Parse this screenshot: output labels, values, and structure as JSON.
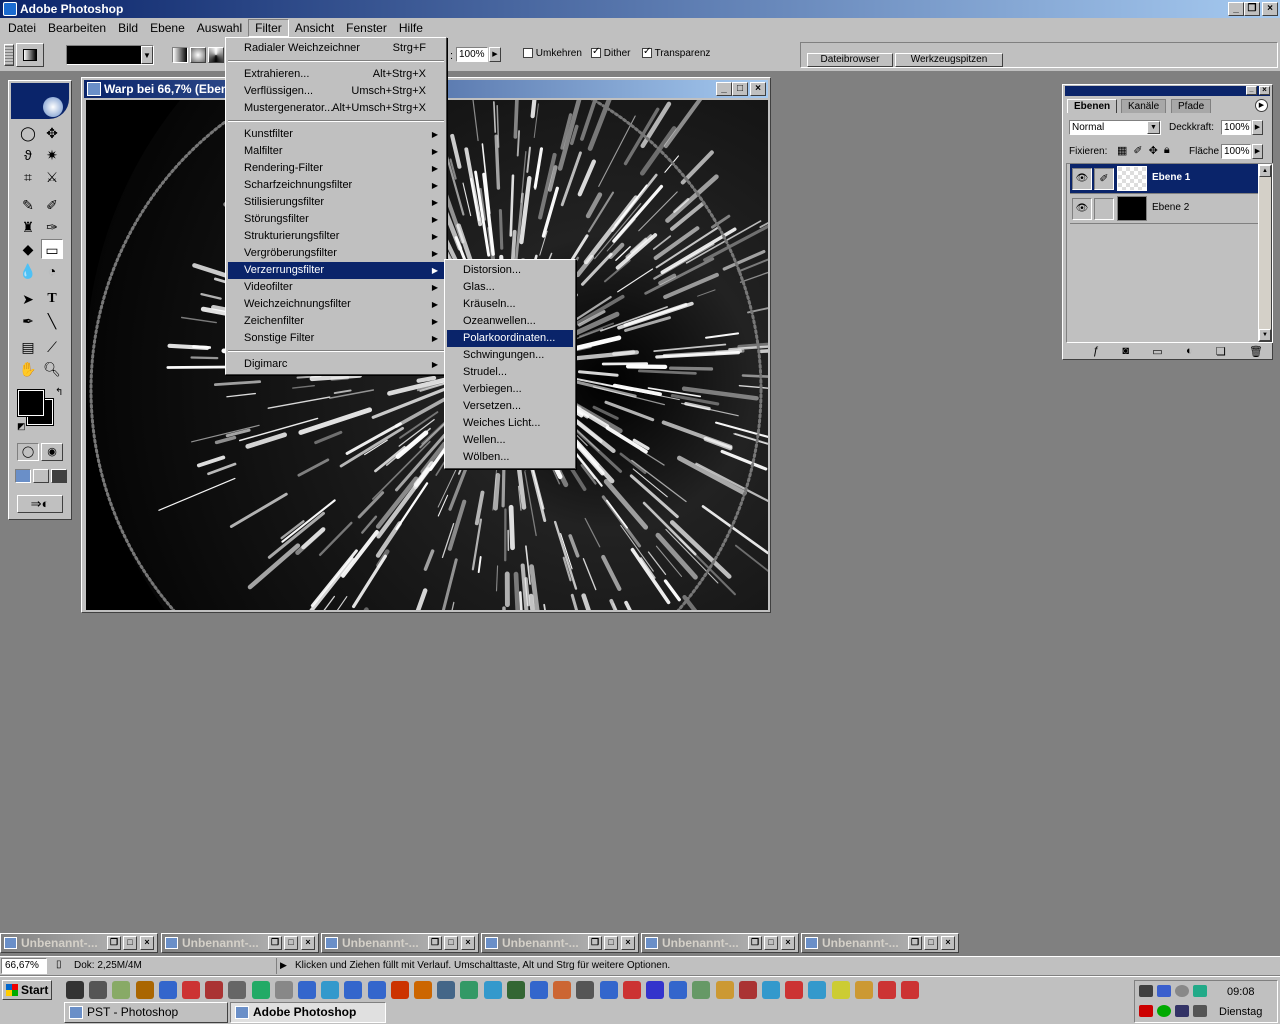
{
  "app": {
    "title": "Adobe Photoshop"
  },
  "menubar": [
    "Datei",
    "Bearbeiten",
    "Bild",
    "Ebene",
    "Auswahl",
    "Filter",
    "Ansicht",
    "Fenster",
    "Hilfe"
  ],
  "options": {
    "opacity_value": "100%",
    "reverse_label": "Umkehren",
    "dither_label": "Dither",
    "transparency_label": "Transparenz",
    "tab_filebrowser": "Dateibrowser",
    "tab_brushes": "Werkzeugspitzen"
  },
  "document": {
    "title": "Warp bei 66,7% (Ebene 1, RGB)"
  },
  "filter_menu": [
    {
      "label": "Radialer Weichzeichner",
      "shortcut": "Strg+F"
    },
    {
      "label": "Extrahieren...",
      "shortcut": "Alt+Strg+X"
    },
    {
      "label": "Verflüssigen...",
      "shortcut": "Umsch+Strg+X"
    },
    {
      "label": "Mustergenerator...",
      "shortcut": "Alt+Umsch+Strg+X"
    },
    {
      "label": "Kunstfilter"
    },
    {
      "label": "Malfilter"
    },
    {
      "label": "Rendering-Filter"
    },
    {
      "label": "Scharfzeichnungsfilter"
    },
    {
      "label": "Stilisierungsfilter"
    },
    {
      "label": "Störungsfilter"
    },
    {
      "label": "Strukturierungsfilter"
    },
    {
      "label": "Vergröberungsfilter"
    },
    {
      "label": "Verzerrungsfilter"
    },
    {
      "label": "Videofilter"
    },
    {
      "label": "Weichzeichnungsfilter"
    },
    {
      "label": "Zeichenfilter"
    },
    {
      "label": "Sonstige Filter"
    },
    {
      "label": "Digimarc"
    }
  ],
  "distort_submenu": [
    "Distorsion...",
    "Glas...",
    "Kräuseln...",
    "Ozeanwellen...",
    "Polarkoordinaten...",
    "Schwingungen...",
    "Strudel...",
    "Verbiegen...",
    "Versetzen...",
    "Weiches Licht...",
    "Wellen...",
    "Wölben..."
  ],
  "layers": {
    "tabs": [
      "Ebenen",
      "Kanäle",
      "Pfade"
    ],
    "blend_mode": "Normal",
    "opacity_label": "Deckkraft:",
    "opacity_value": "100%",
    "lock_label": "Fixieren:",
    "fill_label": "Fläche",
    "fill_value": "100%",
    "items": [
      {
        "name": "Ebene 1"
      },
      {
        "name": "Ebene 2"
      }
    ]
  },
  "minimized_windows": [
    "Unbenannt-...",
    "Unbenannt-...",
    "Unbenannt-...",
    "Unbenannt-...",
    "Unbenannt-...",
    "Unbenannt-..."
  ],
  "status": {
    "zoom": "66,67%",
    "doc_size": "Dok: 2,25M/4M",
    "hint": "Klicken und Ziehen füllt mit Verlauf. Umschalttaste, Alt und Strg für weitere Optionen."
  },
  "taskbar": {
    "start": "Start",
    "tasks": [
      "PST - Photoshop Tutorial...",
      "Adobe Photoshop"
    ],
    "time": "09:08",
    "day": "Dienstag"
  },
  "colors": {
    "titlebar": "#0a246a",
    "face": "#c0c0c0",
    "workspace": "#808080",
    "highlight": "#0a246a"
  }
}
